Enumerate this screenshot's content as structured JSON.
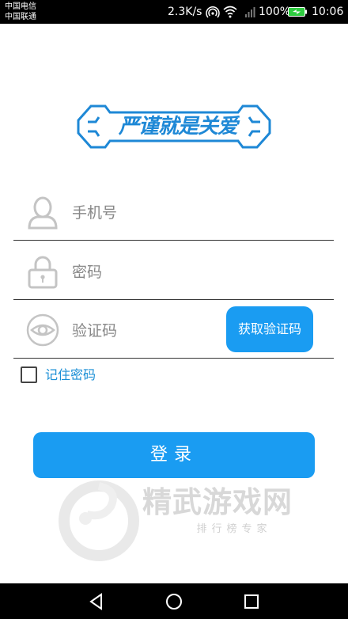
{
  "status_bar": {
    "carrier_1": "中国电信",
    "carrier_2": "中国联通",
    "net_speed": "2.3K/s",
    "battery": "100%",
    "time": "10:06",
    "icons": [
      "hotspot-icon",
      "wifi-icon",
      "signal-icon",
      "battery-charging-icon"
    ]
  },
  "logo": {
    "text": "严谨就是关爱",
    "color": "#1e88d6"
  },
  "form": {
    "phone": {
      "placeholder": "手机号",
      "value": "",
      "icon": "user-icon"
    },
    "password": {
      "placeholder": "密码",
      "value": "",
      "icon": "lock-icon"
    },
    "code": {
      "placeholder": "验证码",
      "value": "",
      "icon": "eye-icon"
    },
    "get_code_label": "获取验证码",
    "remember_label": "记住密码",
    "remember_checked": false,
    "login_label": "登录"
  },
  "watermark": {
    "title": "精武游戏网",
    "subtitle": "排行榜专家"
  },
  "nav_bar": {
    "icons": [
      "back-icon",
      "home-icon",
      "recents-icon"
    ]
  },
  "colors": {
    "accent": "#1a9cf2",
    "link": "#1a8fd6",
    "divider": "#333333"
  }
}
